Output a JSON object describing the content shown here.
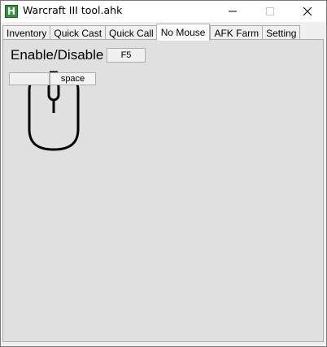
{
  "window": {
    "title": "Warcraft III tool.ahk",
    "icon_letter": "H",
    "icon": "autohotkey-icon",
    "controls": [
      "minimize-icon",
      "maximize-icon",
      "close-icon"
    ]
  },
  "tabs": [
    {
      "label": "Inventory",
      "active": false
    },
    {
      "label": "Quick Cast",
      "active": false
    },
    {
      "label": "Quick Call",
      "active": false
    },
    {
      "label": "No Mouse",
      "active": true
    },
    {
      "label": "AFK Farm",
      "active": false
    },
    {
      "label": "Setting",
      "active": false
    }
  ],
  "no_mouse": {
    "enable_label": "Enable/Disable",
    "enable_hotkey": "F5",
    "left_click_hotkey": "",
    "middle_click_hotkey": "space",
    "illustration": "mouse-icon"
  },
  "colors": {
    "panel_bg": "#e0e0e0",
    "window_bg": "#f0f0f0",
    "icon_green": "#3a8d3a"
  }
}
